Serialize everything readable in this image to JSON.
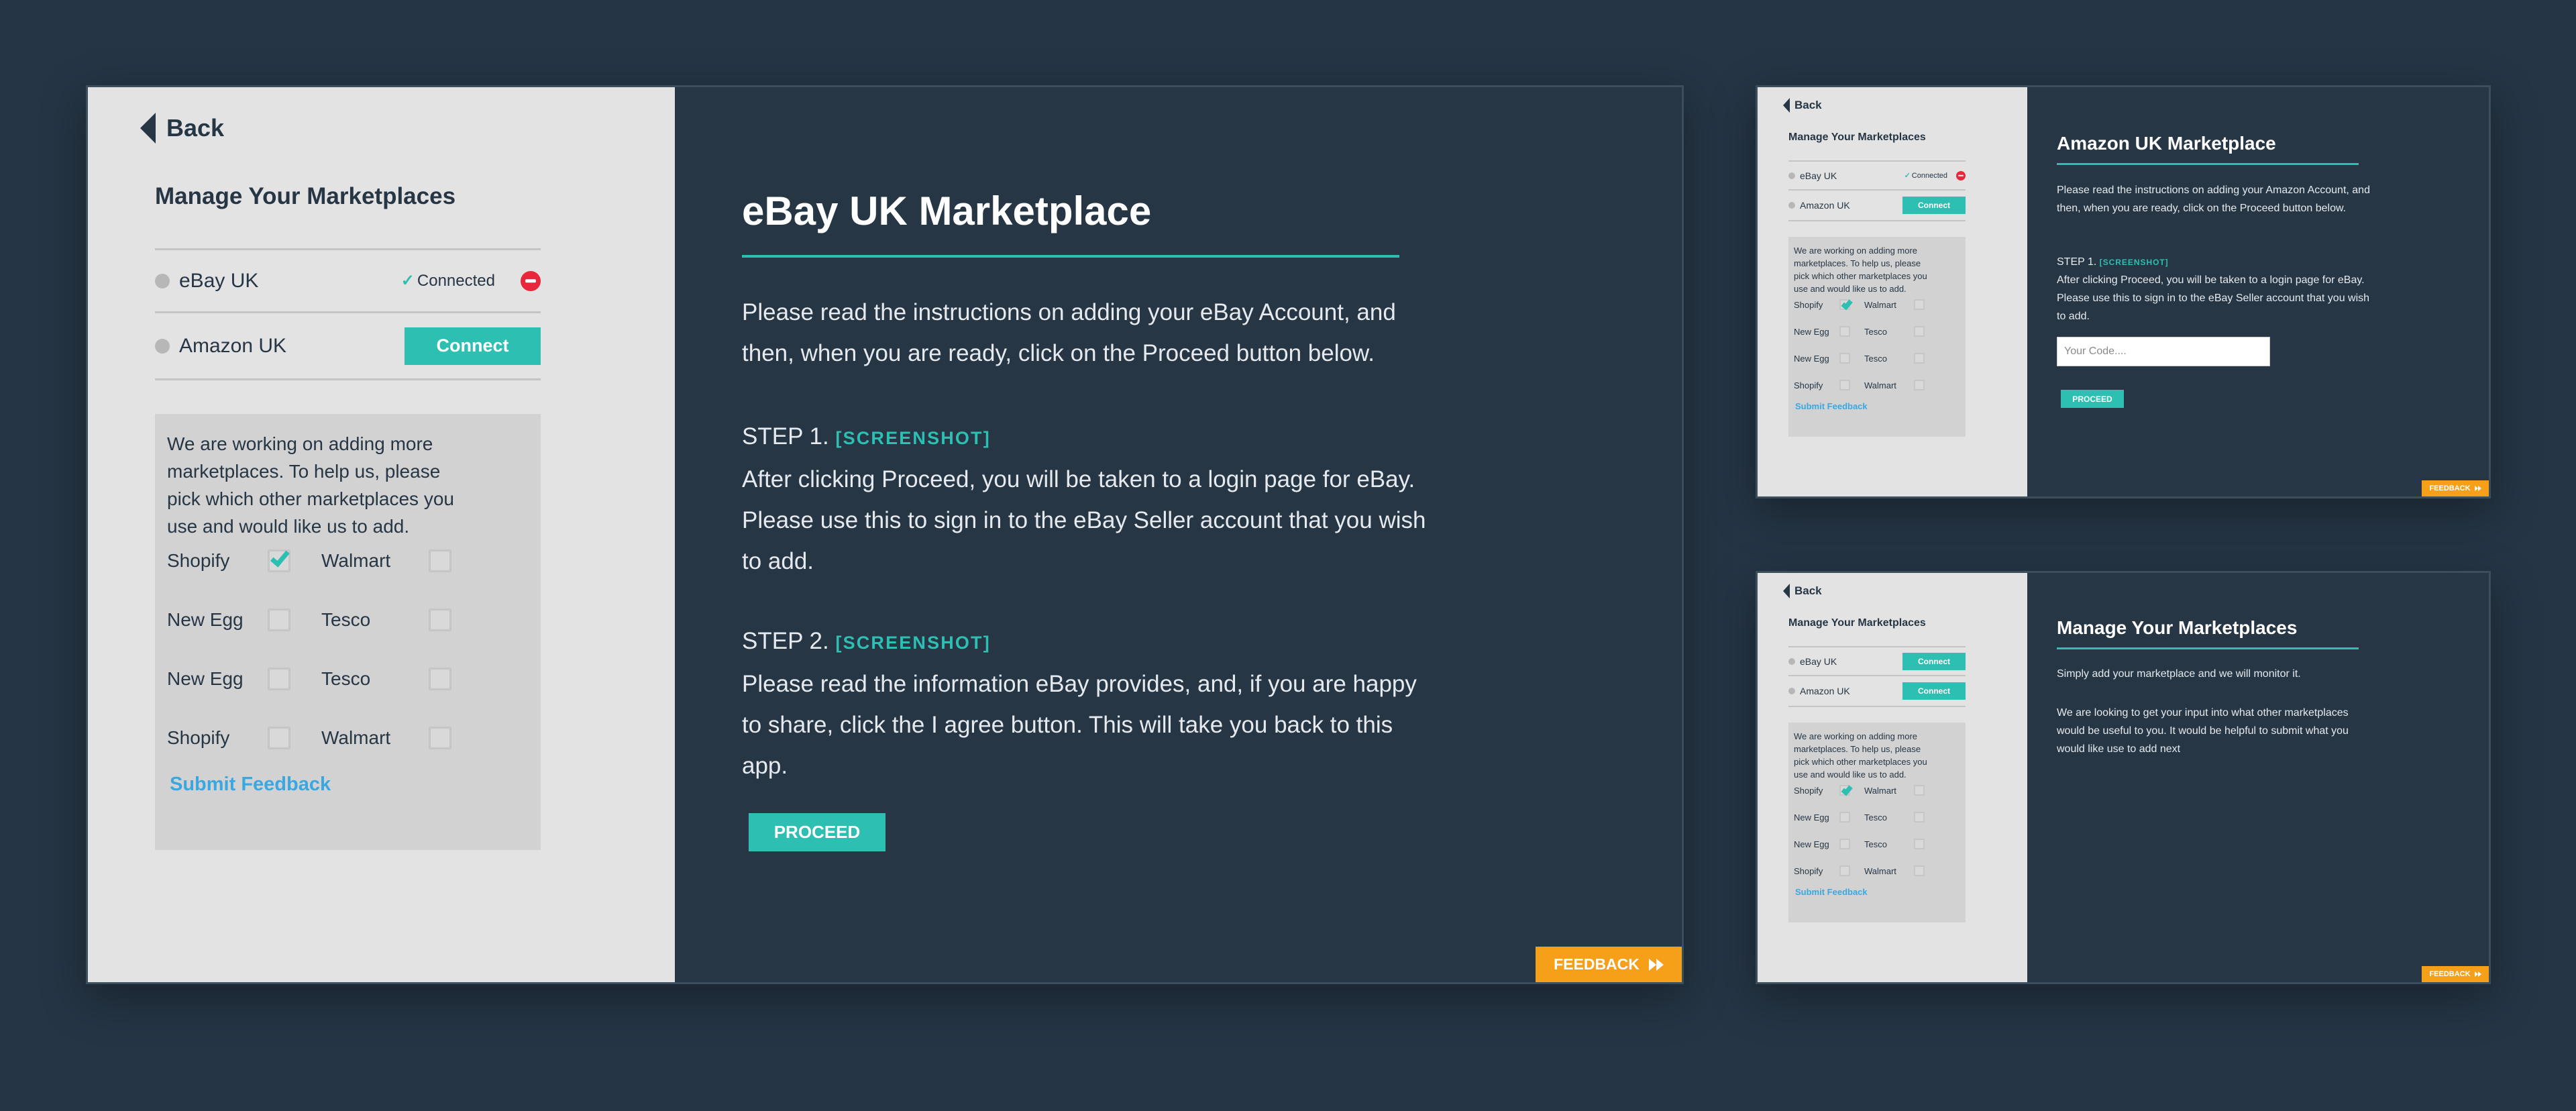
{
  "main": {
    "left": {
      "back_label": "Back",
      "title": "Manage Your Marketplaces",
      "marketplaces": [
        {
          "name": "eBay UK",
          "status": "Connected"
        },
        {
          "name": "Amazon UK",
          "button": "Connect"
        }
      ],
      "feedback_text": "We are working on adding more marketplaces. To help us, please pick which other marketplaces you use and would like us to add.",
      "options": [
        {
          "label": "Shopify",
          "checked": true
        },
        {
          "label": "Walmart",
          "checked": false
        },
        {
          "label": "New Egg",
          "checked": false
        },
        {
          "label": "Tesco",
          "checked": false
        },
        {
          "label": "New Egg",
          "checked": false
        },
        {
          "label": "Tesco",
          "checked": false
        },
        {
          "label": "Shopify",
          "checked": false
        },
        {
          "label": "Walmart",
          "checked": false
        }
      ],
      "submit_label": "Submit Feedback"
    },
    "right": {
      "title": "eBay UK Marketplace",
      "intro": "Please read the instructions on adding your eBay Account, and then, when you are ready, click on the Proceed button below.",
      "step1_label": "STEP 1.",
      "step1_tag": "[SCREENSHOT]",
      "step1_text": "After clicking Proceed, you will be taken to a login page for eBay. Please use this to sign in to the eBay Seller account that you wish to add.",
      "step2_label": "STEP 2.",
      "step2_tag": "[SCREENSHOT]",
      "step2_text": "Please read the information eBay provides, and, if you are happy to share, click the I agree button. This will take you back to this app.",
      "proceed_label": "PROCEED"
    },
    "feedback_label": "FEEDBACK"
  },
  "amazon": {
    "left": {
      "back_label": "Back",
      "title": "Manage Your Marketplaces",
      "marketplaces": [
        {
          "name": "eBay UK",
          "status": "Connected"
        },
        {
          "name": "Amazon UK",
          "button": "Connect"
        }
      ],
      "feedback_text": "We are working on adding more marketplaces. To help us, please pick which other marketplaces you use and would like us to add.",
      "options": [
        {
          "label": "Shopify",
          "checked": true
        },
        {
          "label": "Walmart",
          "checked": false
        },
        {
          "label": "New Egg",
          "checked": false
        },
        {
          "label": "Tesco",
          "checked": false
        },
        {
          "label": "New Egg",
          "checked": false
        },
        {
          "label": "Tesco",
          "checked": false
        },
        {
          "label": "Shopify",
          "checked": false
        },
        {
          "label": "Walmart",
          "checked": false
        }
      ],
      "submit_label": "Submit Feedback"
    },
    "right": {
      "title": "Amazon UK Marketplace",
      "intro": "Please read the instructions on adding your Amazon Account, and then, when you are ready, click on the Proceed button below.",
      "step1_label": "STEP 1.",
      "step1_tag": "[SCREENSHOT]",
      "step1_text": "After clicking Proceed, you will be taken to a login page for eBay. Please use this to sign in to the eBay Seller account that you wish to add.",
      "code_placeholder": "Your Code....",
      "proceed_label": "PROCEED"
    },
    "feedback_label": "FEEDBACK"
  },
  "manage": {
    "left": {
      "back_label": "Back",
      "title": "Manage Your Marketplaces",
      "marketplaces": [
        {
          "name": "eBay UK",
          "button": "Connect"
        },
        {
          "name": "Amazon UK",
          "button": "Connect"
        }
      ],
      "feedback_text": "We are working on adding more marketplaces. To help us, please pick which other marketplaces you use and would like us to add.",
      "options": [
        {
          "label": "Shopify",
          "checked": true
        },
        {
          "label": "Walmart",
          "checked": false
        },
        {
          "label": "New Egg",
          "checked": false
        },
        {
          "label": "Tesco",
          "checked": false
        },
        {
          "label": "New Egg",
          "checked": false
        },
        {
          "label": "Tesco",
          "checked": false
        },
        {
          "label": "Shopify",
          "checked": false
        },
        {
          "label": "Walmart",
          "checked": false
        }
      ],
      "submit_label": "Submit Feedback"
    },
    "right": {
      "title": "Manage Your Marketplaces",
      "p1": "Simply add your marketplace and we will monitor it.",
      "p2": "We are looking to get your input into what other marketplaces would be useful to you. It would be helpful to submit what you would like use to add next"
    },
    "feedback_label": "FEEDBACK"
  },
  "colors": {
    "background": "#253545",
    "panel_dark": "#263645",
    "panel_light": "#e3e3e3",
    "accent_teal": "#2ebfb3",
    "feedback_orange": "#f6a01a",
    "remove_red": "#e8283a",
    "link_blue": "#3aa7e0"
  },
  "icons": {
    "back": "back-triangle-icon",
    "connected": "checkmark-icon",
    "remove": "remove-circle-icon",
    "feedback": "fast-forward-icon"
  }
}
